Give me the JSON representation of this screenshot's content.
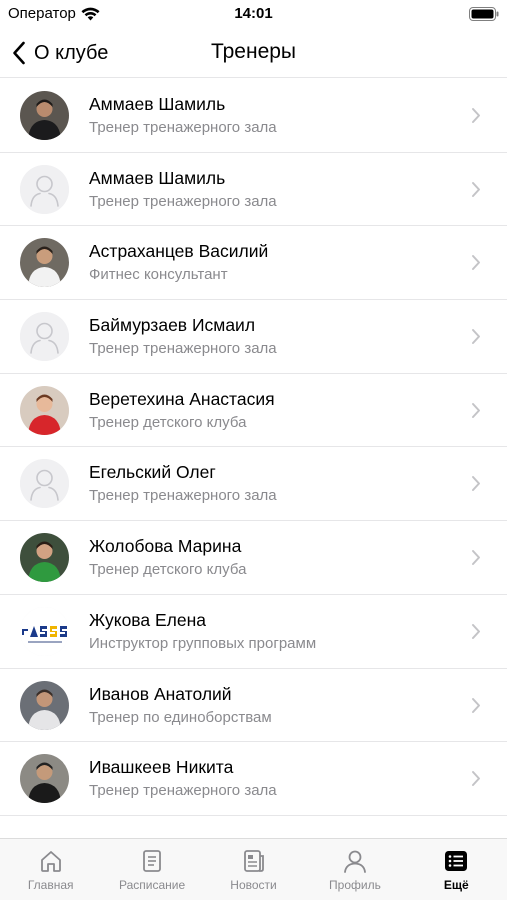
{
  "status_bar": {
    "carrier": "Оператор",
    "time": "14:01"
  },
  "nav": {
    "back_label": "О клубе",
    "title": "Тренеры"
  },
  "trainers": [
    {
      "name": "Аммаев Шамиль",
      "role": "Тренер тренажерного зала",
      "avatar": "photo-dark"
    },
    {
      "name": "Аммаев Шамиль",
      "role": "Тренер тренажерного зала",
      "avatar": "placeholder"
    },
    {
      "name": "Астраханцев Василий",
      "role": "Фитнес консультант",
      "avatar": "photo-white"
    },
    {
      "name": "Баймурзаев Исмаил",
      "role": "Тренер тренажерного зала",
      "avatar": "placeholder"
    },
    {
      "name": "Веретехина Анастасия",
      "role": "Тренер детского клуба",
      "avatar": "photo-red"
    },
    {
      "name": "Егельский Олег",
      "role": "Тренер тренажерного зала",
      "avatar": "placeholder"
    },
    {
      "name": "Жолобова Марина",
      "role": "Тренер детского клуба",
      "avatar": "photo-green"
    },
    {
      "name": "Жукова Елена",
      "role": "Инструктор групповых программ",
      "avatar": "logo"
    },
    {
      "name": "Иванов Анатолий",
      "role": "Тренер по единоборствам",
      "avatar": "photo-grey"
    },
    {
      "name": "Ивашкеев Никита",
      "role": "Тренер тренажерного зала",
      "avatar": "photo-dark2"
    }
  ],
  "tabs": [
    {
      "label": "Главная",
      "icon": "home-icon",
      "active": false
    },
    {
      "label": "Расписание",
      "icon": "schedule-icon",
      "active": false
    },
    {
      "label": "Новости",
      "icon": "news-icon",
      "active": false
    },
    {
      "label": "Профиль",
      "icon": "profile-icon",
      "active": false
    },
    {
      "label": "Ещё",
      "icon": "more-icon",
      "active": true
    }
  ],
  "colors": {
    "accent": "#000000",
    "secondary_text": "#8a8a8e",
    "separator": "#e6e6e8",
    "tab_bar_bg": "#f8f8f8"
  }
}
